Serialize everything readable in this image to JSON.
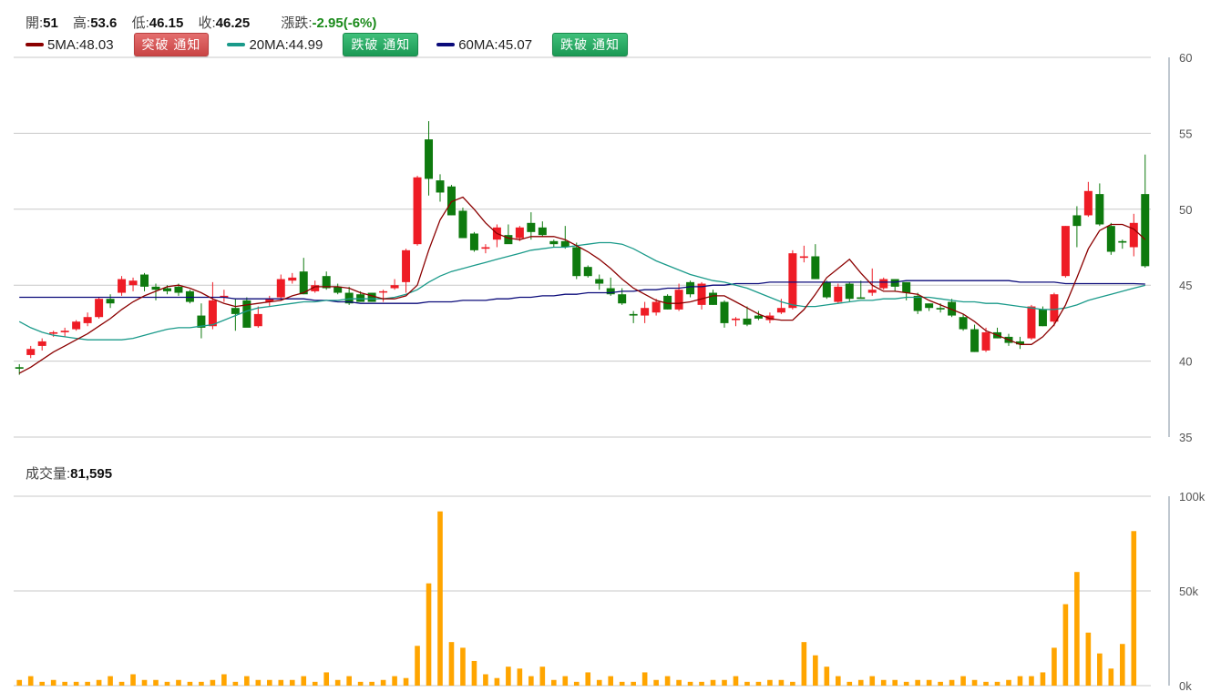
{
  "info": {
    "open_label": "開:",
    "open": "51",
    "high_label": "高:",
    "high": "53.6",
    "low_label": "低:",
    "low": "46.15",
    "close_label": "收:",
    "close": "46.25",
    "change_label": "漲跌:",
    "change": "-2.95(-6%)"
  },
  "legend": [
    {
      "label": "5MA:48.03",
      "color": "#8b0000",
      "button": "突破 通知",
      "button_style": "red"
    },
    {
      "label": "20MA:44.99",
      "color": "#1a9a8a",
      "button": "跌破 通知",
      "button_style": "green"
    },
    {
      "label": "60MA:45.07",
      "color": "#0b0b7a",
      "button": "跌破 通知",
      "button_style": "green"
    }
  ],
  "volume_label": {
    "label": "成交量:",
    "value": "81,595"
  },
  "chart_data": [
    {
      "type": "candlestick",
      "y_ticks": [
        "60",
        "55",
        "50",
        "45",
        "40",
        "35"
      ],
      "ylim": [
        35,
        60
      ],
      "grid": true,
      "up_color": "#ee1c25",
      "down_color": "#0e7a0e",
      "candles": [
        [
          39.6,
          39.8,
          39.1,
          39.5
        ],
        [
          40.4,
          41.0,
          40.2,
          40.8
        ],
        [
          41.0,
          41.5,
          40.7,
          41.3
        ],
        [
          41.8,
          42.0,
          41.6,
          41.9
        ],
        [
          41.9,
          42.2,
          41.6,
          42.0
        ],
        [
          42.1,
          42.7,
          42.0,
          42.6
        ],
        [
          42.5,
          43.2,
          42.3,
          42.9
        ],
        [
          42.9,
          44.2,
          42.8,
          44.1
        ],
        [
          44.1,
          44.4,
          43.5,
          43.8
        ],
        [
          44.5,
          45.6,
          44.3,
          45.4
        ],
        [
          45.0,
          45.5,
          44.6,
          45.3
        ],
        [
          45.7,
          45.8,
          44.6,
          44.9
        ],
        [
          44.9,
          45.1,
          44.0,
          44.7
        ],
        [
          44.8,
          45.0,
          44.4,
          44.6
        ],
        [
          44.9,
          45.1,
          44.3,
          44.5
        ],
        [
          44.6,
          44.7,
          43.8,
          43.9
        ],
        [
          43.0,
          43.8,
          41.5,
          42.2
        ],
        [
          42.3,
          45.2,
          42.1,
          44.0
        ],
        [
          44.2,
          44.7,
          43.9,
          44.3
        ],
        [
          43.5,
          44.1,
          42.0,
          43.1
        ],
        [
          44.0,
          44.2,
          42.7,
          42.2
        ],
        [
          42.3,
          43.6,
          42.2,
          43.1
        ],
        [
          43.9,
          44.3,
          43.6,
          44.1
        ],
        [
          44.2,
          45.7,
          44.0,
          45.4
        ],
        [
          45.3,
          45.8,
          45.1,
          45.5
        ],
        [
          45.9,
          46.8,
          44.4,
          44.4
        ],
        [
          44.6,
          45.3,
          44.5,
          45.0
        ],
        [
          45.6,
          45.9,
          44.7,
          44.8
        ],
        [
          44.9,
          45.1,
          44.4,
          44.5
        ],
        [
          44.5,
          44.9,
          43.7,
          43.8
        ],
        [
          44.4,
          44.6,
          43.9,
          43.9
        ],
        [
          44.5,
          44.5,
          43.9,
          43.9
        ],
        [
          44.6,
          44.7,
          43.9,
          44.6
        ],
        [
          44.8,
          45.4,
          44.7,
          45.0
        ],
        [
          45.2,
          47.4,
          44.5,
          47.3
        ],
        [
          47.7,
          52.2,
          47.6,
          52.1
        ],
        [
          54.6,
          55.8,
          50.9,
          52.0
        ],
        [
          51.9,
          52.3,
          50.5,
          51.1
        ],
        [
          51.5,
          51.6,
          49.6,
          49.6
        ],
        [
          49.9,
          50.1,
          48.1,
          48.1
        ],
        [
          48.4,
          48.5,
          47.2,
          47.3
        ],
        [
          47.4,
          47.7,
          47.1,
          47.5
        ],
        [
          48.0,
          49.0,
          47.5,
          48.8
        ],
        [
          48.3,
          49.0,
          47.8,
          47.7
        ],
        [
          48.1,
          48.9,
          47.9,
          48.8
        ],
        [
          49.1,
          49.8,
          48.0,
          48.5
        ],
        [
          48.8,
          49.2,
          48.2,
          48.3
        ],
        [
          47.9,
          48.0,
          47.5,
          47.7
        ],
        [
          47.9,
          48.9,
          47.4,
          47.5
        ],
        [
          47.5,
          47.8,
          45.4,
          45.6
        ],
        [
          46.2,
          46.3,
          45.5,
          45.6
        ],
        [
          45.4,
          45.7,
          44.7,
          45.1
        ],
        [
          44.8,
          45.5,
          44.3,
          44.4
        ],
        [
          44.4,
          44.8,
          43.7,
          43.8
        ],
        [
          43.1,
          43.3,
          42.5,
          43.0
        ],
        [
          43.0,
          43.9,
          42.5,
          43.5
        ],
        [
          43.2,
          44.1,
          43.0,
          43.9
        ],
        [
          44.3,
          44.4,
          43.4,
          43.4
        ],
        [
          43.4,
          45.1,
          43.3,
          44.7
        ],
        [
          45.2,
          45.3,
          44.2,
          44.4
        ],
        [
          43.7,
          45.2,
          43.4,
          45.1
        ],
        [
          44.5,
          44.7,
          43.7,
          43.7
        ],
        [
          43.9,
          44.0,
          42.2,
          42.5
        ],
        [
          42.7,
          42.9,
          42.3,
          42.8
        ],
        [
          42.8,
          43.6,
          42.3,
          42.4
        ],
        [
          43.0,
          43.3,
          42.7,
          42.8
        ],
        [
          42.7,
          43.2,
          42.5,
          43.0
        ],
        [
          43.2,
          44.1,
          43.1,
          43.5
        ],
        [
          43.5,
          47.3,
          43.4,
          47.1
        ],
        [
          46.8,
          47.6,
          46.5,
          46.9
        ],
        [
          46.9,
          47.7,
          45.4,
          45.4
        ],
        [
          45.2,
          45.3,
          44.1,
          44.2
        ],
        [
          43.9,
          45.1,
          43.8,
          44.9
        ],
        [
          45.1,
          45.2,
          43.9,
          44.1
        ],
        [
          44.2,
          45.3,
          44.2,
          44.1
        ],
        [
          44.5,
          46.1,
          44.3,
          44.7
        ],
        [
          44.8,
          45.5,
          44.7,
          45.4
        ],
        [
          45.4,
          45.4,
          44.6,
          44.9
        ],
        [
          45.2,
          45.2,
          44.0,
          44.5
        ],
        [
          44.3,
          44.5,
          43.1,
          43.3
        ],
        [
          43.8,
          43.8,
          43.3,
          43.5
        ],
        [
          43.5,
          43.8,
          43.2,
          43.4
        ],
        [
          43.9,
          44.1,
          42.9,
          43.0
        ],
        [
          42.9,
          43.1,
          42.0,
          42.1
        ],
        [
          42.1,
          42.4,
          40.6,
          40.6
        ],
        [
          40.7,
          42.2,
          40.6,
          41.9
        ],
        [
          41.9,
          42.2,
          41.5,
          41.5
        ],
        [
          41.6,
          41.8,
          41.0,
          41.2
        ],
        [
          41.3,
          41.6,
          40.8,
          41.1
        ],
        [
          41.5,
          43.7,
          41.4,
          43.6
        ],
        [
          43.4,
          43.6,
          42.3,
          42.3
        ],
        [
          42.6,
          44.5,
          42.3,
          44.4
        ],
        [
          45.6,
          48.9,
          45.5,
          48.9
        ],
        [
          49.6,
          50.2,
          47.5,
          48.9
        ],
        [
          49.6,
          51.8,
          49.5,
          51.2
        ],
        [
          51.0,
          51.7,
          48.9,
          49.0
        ],
        [
          48.9,
          49.1,
          47.0,
          47.2
        ],
        [
          47.9,
          48.0,
          47.4,
          47.8
        ],
        [
          47.5,
          49.7,
          46.9,
          49.1
        ],
        [
          51.0,
          53.6,
          46.15,
          46.25
        ]
      ],
      "ma5": [
        39.2,
        39.6,
        40.1,
        40.6,
        41.0,
        41.4,
        41.8,
        42.3,
        42.8,
        43.4,
        43.9,
        44.3,
        44.6,
        44.9,
        45.0,
        44.8,
        44.5,
        44.1,
        43.8,
        43.6,
        43.7,
        43.8,
        43.9,
        44.0,
        44.3,
        44.5,
        44.9,
        44.9,
        44.9,
        44.8,
        44.5,
        44.3,
        44.1,
        44.1,
        44.3,
        45.0,
        47.3,
        49.3,
        50.5,
        50.8,
        50.0,
        49.1,
        48.4,
        48.1,
        48.0,
        48.2,
        48.2,
        48.2,
        48.0,
        47.6,
        47.2,
        46.7,
        46.1,
        45.4,
        44.8,
        44.4,
        44.0,
        43.8,
        43.8,
        43.9,
        44.1,
        44.3,
        44.3,
        43.9,
        43.5,
        43.1,
        42.8,
        42.7,
        42.7,
        43.4,
        44.4,
        45.5,
        46.1,
        46.7,
        45.8,
        45.0,
        44.6,
        44.6,
        44.5,
        44.4,
        44.0,
        43.7,
        43.4,
        43.1,
        42.6,
        42.0,
        41.7,
        41.4,
        41.1,
        41.1,
        41.6,
        42.4,
        43.7,
        45.5,
        47.4,
        48.6,
        49.0,
        49.0,
        48.7,
        48.0
      ],
      "ma20": [
        42.6,
        42.2,
        41.9,
        41.7,
        41.6,
        41.5,
        41.4,
        41.4,
        41.4,
        41.4,
        41.5,
        41.7,
        41.9,
        42.1,
        42.2,
        42.2,
        42.3,
        42.4,
        42.7,
        43.0,
        43.3,
        43.5,
        43.6,
        43.7,
        43.8,
        43.9,
        43.9,
        44.0,
        44.0,
        44.1,
        44.1,
        44.1,
        44.1,
        44.2,
        44.4,
        44.7,
        45.2,
        45.6,
        45.9,
        46.1,
        46.3,
        46.5,
        46.7,
        46.9,
        47.1,
        47.3,
        47.4,
        47.5,
        47.5,
        47.6,
        47.7,
        47.8,
        47.8,
        47.7,
        47.4,
        47.0,
        46.6,
        46.3,
        46.0,
        45.7,
        45.5,
        45.3,
        45.2,
        45.0,
        44.8,
        44.5,
        44.2,
        43.9,
        43.7,
        43.6,
        43.6,
        43.7,
        43.8,
        43.9,
        44.0,
        44.0,
        44.1,
        44.1,
        44.2,
        44.2,
        44.2,
        44.1,
        44.0,
        43.9,
        43.9,
        43.8,
        43.8,
        43.7,
        43.6,
        43.5,
        43.4,
        43.4,
        43.5,
        43.7,
        44.0,
        44.2,
        44.4,
        44.6,
        44.8,
        44.99
      ],
      "ma60": [
        44.2,
        44.2,
        44.2,
        44.2,
        44.2,
        44.2,
        44.2,
        44.2,
        44.2,
        44.2,
        44.2,
        44.2,
        44.2,
        44.2,
        44.2,
        44.2,
        44.2,
        44.2,
        44.2,
        44.1,
        44.1,
        44.1,
        44.1,
        44.1,
        44.1,
        44.1,
        44.0,
        44.0,
        43.9,
        43.9,
        43.8,
        43.8,
        43.8,
        43.8,
        43.8,
        43.8,
        43.9,
        43.9,
        43.9,
        44.0,
        44.0,
        44.0,
        44.1,
        44.1,
        44.2,
        44.2,
        44.3,
        44.3,
        44.4,
        44.4,
        44.5,
        44.5,
        44.5,
        44.6,
        44.6,
        44.7,
        44.7,
        44.8,
        44.8,
        44.9,
        44.9,
        45.0,
        45.0,
        45.1,
        45.1,
        45.1,
        45.2,
        45.2,
        45.2,
        45.2,
        45.2,
        45.2,
        45.2,
        45.2,
        45.2,
        45.2,
        45.2,
        45.2,
        45.3,
        45.3,
        45.3,
        45.3,
        45.3,
        45.3,
        45.3,
        45.3,
        45.3,
        45.3,
        45.2,
        45.2,
        45.2,
        45.2,
        45.1,
        45.1,
        45.1,
        45.1,
        45.1,
        45.1,
        45.1,
        45.07
      ]
    },
    {
      "type": "bar",
      "y_ticks": [
        "100k",
        "50k",
        "0k"
      ],
      "ylim": [
        0,
        100000
      ],
      "grid": true,
      "color": "#ffa500",
      "values": [
        3000,
        5000,
        2000,
        3000,
        2000,
        2000,
        2000,
        3000,
        5000,
        2000,
        6000,
        3000,
        3000,
        2000,
        3000,
        2000,
        2000,
        3000,
        6000,
        2000,
        5000,
        3000,
        3000,
        3000,
        3000,
        5000,
        2000,
        7000,
        3000,
        5000,
        2000,
        2000,
        3000,
        5000,
        4000,
        21000,
        54000,
        92000,
        23000,
        20000,
        13000,
        6000,
        4000,
        10000,
        9000,
        5000,
        10000,
        3000,
        5000,
        2000,
        7000,
        3000,
        5000,
        2000,
        2000,
        7000,
        3000,
        5000,
        3000,
        2000,
        2000,
        3000,
        3000,
        5000,
        2000,
        2000,
        3000,
        3000,
        2000,
        23000,
        16000,
        10000,
        5000,
        2000,
        3000,
        5000,
        3000,
        3000,
        2000,
        3000,
        3000,
        2000,
        3000,
        5000,
        3000,
        2000,
        2000,
        3000,
        5000,
        5000,
        7000,
        20000,
        43000,
        60000,
        28000,
        17000,
        9000,
        22000,
        81595
      ]
    }
  ]
}
